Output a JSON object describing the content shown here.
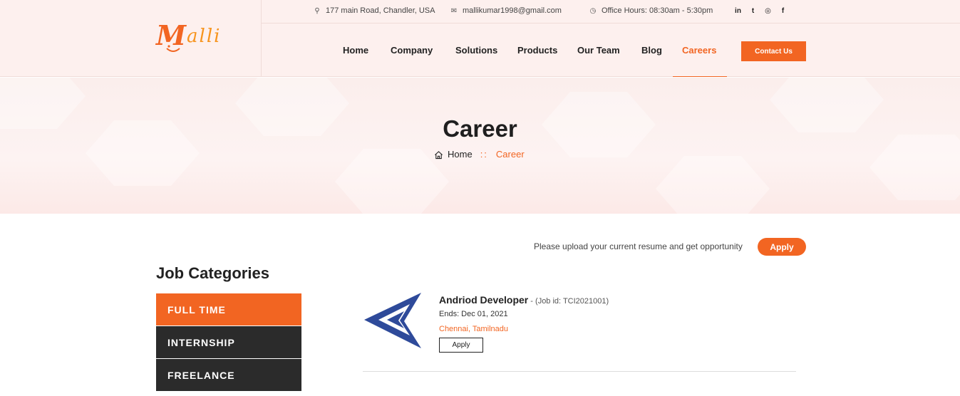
{
  "brand": {
    "logo_mark": "M",
    "logo_rest": "alli"
  },
  "topbar": {
    "address": "177 main Road, Chandler, USA",
    "email": "mallikumar1998@gmail.com",
    "hours": "Office Hours: 08:30am - 5:30pm",
    "social": [
      {
        "icon": "linkedin-icon",
        "glyph": "in"
      },
      {
        "icon": "twitter-icon",
        "glyph": "t"
      },
      {
        "icon": "instagram-icon",
        "glyph": "◎"
      },
      {
        "icon": "facebook-icon",
        "glyph": "f"
      }
    ]
  },
  "nav": {
    "items": [
      {
        "label": "Home"
      },
      {
        "label": "Company"
      },
      {
        "label": "Solutions"
      },
      {
        "label": "Products"
      },
      {
        "label": "Our Team"
      },
      {
        "label": "Blog"
      },
      {
        "label": "Careers",
        "active": true
      }
    ],
    "contact_label": "Contact Us"
  },
  "banner": {
    "title": "Career",
    "breadcrumb_home": "Home",
    "breadcrumb_sep": "::",
    "breadcrumb_current": "Career"
  },
  "upload": {
    "text": "Please upload your current resume and get opportunity",
    "apply_label": "Apply"
  },
  "categories": {
    "title": "Job Categories",
    "items": [
      {
        "label": "FULL TIME",
        "active": true
      },
      {
        "label": "INTERNSHIP"
      },
      {
        "label": "FREELANCE"
      }
    ]
  },
  "jobs": [
    {
      "title": "Andriod Developer",
      "id_text": " - (Job id: TCI2021001)",
      "ends": "Ends: Dec 01, 2021",
      "location": "Chennai, Tamilnadu",
      "apply_label": "Apply"
    }
  ],
  "colors": {
    "accent": "#f26522",
    "dark": "#2b2b2b",
    "header_bg": "#fdf0ee"
  }
}
